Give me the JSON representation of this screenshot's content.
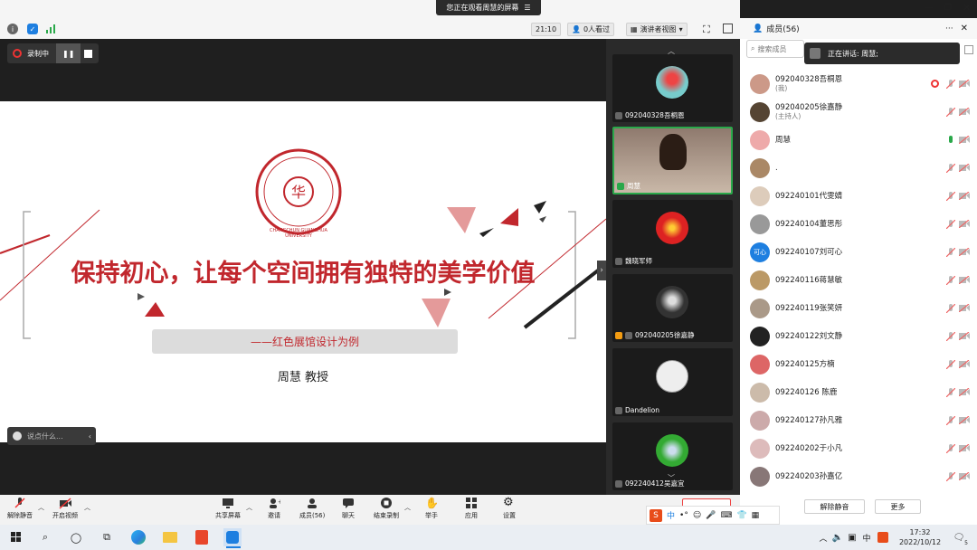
{
  "window": {
    "banner": "您正在观看周慧的屏幕",
    "clock": "21:10",
    "viewers": "0人看过",
    "view_mode": "演讲者视图"
  },
  "recording": {
    "label": "录制中"
  },
  "slide": {
    "university_en": "CHANGCHUN GUANGHUA UNIVERSITY",
    "title": "保持初心，让每个空间拥有独特的美学价值",
    "subtitle": "——红色展馆设计为例",
    "author": "周慧  教授"
  },
  "chat": {
    "placeholder": "说点什么..."
  },
  "video_tiles": [
    {
      "name": "092040328吾桐恩"
    },
    {
      "name": "周慧"
    },
    {
      "name": "魏晓军师"
    },
    {
      "name": "092040205徐嘉静"
    },
    {
      "name": "Dandelion"
    },
    {
      "name": "092240412吴嘉宜"
    }
  ],
  "panel": {
    "title": "成员(56)",
    "search_placeholder": "搜索成员",
    "speaking": "正在讲话: 周慧;",
    "members": [
      {
        "name": "092040328吾桐恩",
        "role": "(我)"
      },
      {
        "name": "092040205徐嘉静",
        "role": "(主持人)"
      },
      {
        "name": "周慧",
        "role": ""
      },
      {
        "name": ".",
        "role": ""
      },
      {
        "name": "092240101代雯婧",
        "role": ""
      },
      {
        "name": "092240104董思彤",
        "role": ""
      },
      {
        "name": "092240107刘可心",
        "role": "",
        "avatar_text": "可心"
      },
      {
        "name": "092240116蒋慧敏",
        "role": ""
      },
      {
        "name": "092240119张笑妍",
        "role": ""
      },
      {
        "name": "092240122刘文静",
        "role": ""
      },
      {
        "name": "092240125方楠",
        "role": ""
      },
      {
        "name": "092240126 陈鹿",
        "role": ""
      },
      {
        "name": "092240127孙凡雅",
        "role": ""
      },
      {
        "name": "092240202于小凡",
        "role": ""
      },
      {
        "name": "092240203孙嘉亿",
        "role": ""
      }
    ],
    "unmute_all": "解除静音",
    "more": "更多"
  },
  "toolbar": {
    "unmute": "解除静音",
    "video": "开启视频",
    "share": "共享屏幕",
    "invite": "邀请",
    "members": "成员(56)",
    "chat": "聊天",
    "end_record": "结束录制",
    "raise_hand": "举手",
    "apps": "应用",
    "settings": "设置"
  },
  "taskbar": {
    "ime": "中",
    "ime_mode": "中",
    "time": "17:32",
    "date": "2022/10/12",
    "notifications": "5"
  },
  "colors": {
    "accent": "#c1272d",
    "blue": "#1e7fe0"
  }
}
